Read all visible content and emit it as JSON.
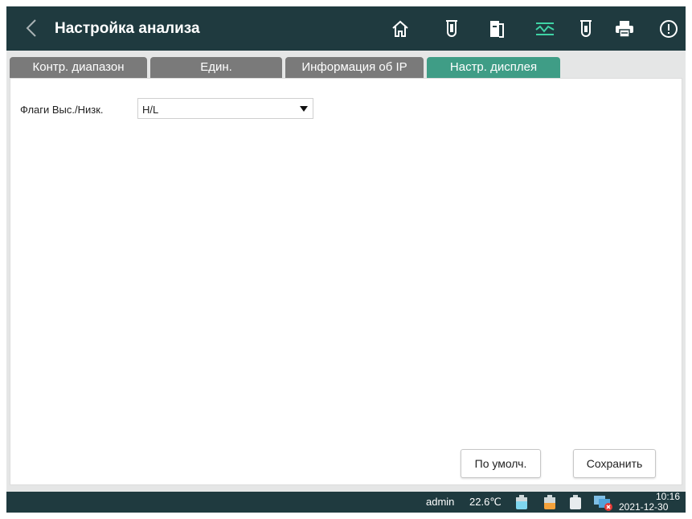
{
  "header": {
    "title": "Настройка анализа",
    "icons": [
      "home-icon",
      "test-tube-icon",
      "exit-icon",
      "waveform-icon",
      "sample-tube-icon",
      "printer-icon",
      "alert-icon"
    ]
  },
  "tabs": [
    {
      "label": "Контр. диапазон",
      "active": false
    },
    {
      "label": "Един.",
      "active": false
    },
    {
      "label": "Информация об IP",
      "active": false
    },
    {
      "label": "Настр. дисплея",
      "active": true
    }
  ],
  "display_settings": {
    "flags_label": "Флаги Выс./Низк.",
    "flags_value": "H/L"
  },
  "buttons": {
    "default_label": "По умолч.",
    "save_label": "Сохранить"
  },
  "status": {
    "user": "admin",
    "temperature": "22.6℃",
    "time": "10:16",
    "date": "2021-12-30"
  },
  "colors": {
    "header_bg": "#1f3a3f",
    "tab_active": "#3f9d86",
    "tab_inactive": "#7a7a7a"
  }
}
